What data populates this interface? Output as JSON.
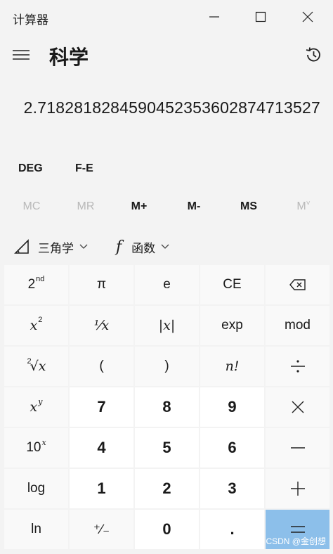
{
  "window": {
    "title": "计算器"
  },
  "header": {
    "mode": "科学"
  },
  "display": {
    "value": "2.7182818284590452353602874713527"
  },
  "modes": {
    "angle": "DEG",
    "notation": "F-E"
  },
  "memory": [
    {
      "label": "MC",
      "enabled": false
    },
    {
      "label": "MR",
      "enabled": false
    },
    {
      "label": "M+",
      "enabled": true
    },
    {
      "label": "M-",
      "enabled": true
    },
    {
      "label": "MS",
      "enabled": true
    },
    {
      "label": "M",
      "enabled": false
    }
  ],
  "functions": {
    "trig": "三角学",
    "func": "函数"
  },
  "keys": {
    "second_base": "2",
    "second_sup": "nd",
    "pi": "π",
    "e": "e",
    "ce": "CE",
    "square_base": "x",
    "square_sup": "2",
    "reciprocal": "¹⁄x",
    "abs": "|x|",
    "exp": "exp",
    "mod": "mod",
    "sqrt_index": "2",
    "sqrt_body": "√x",
    "lparen": "(",
    "rparen": ")",
    "fact": "n!",
    "power_base": "x",
    "power_sup": "y",
    "seven": "7",
    "eight": "8",
    "nine": "9",
    "tenpow_base": "10",
    "tenpow_sup": "x",
    "four": "4",
    "five": "5",
    "six": "6",
    "log": "log",
    "one": "1",
    "two": "2",
    "three": "3",
    "ln": "ln",
    "negate": "⁺∕₋",
    "zero": "0",
    "decimal": "."
  },
  "watermark": "CSDN @金创想",
  "colors": {
    "background": "#f3f3f3",
    "equals": "#8cbfea",
    "number_key": "#ffffff",
    "func_key": "#f9f9f9"
  }
}
